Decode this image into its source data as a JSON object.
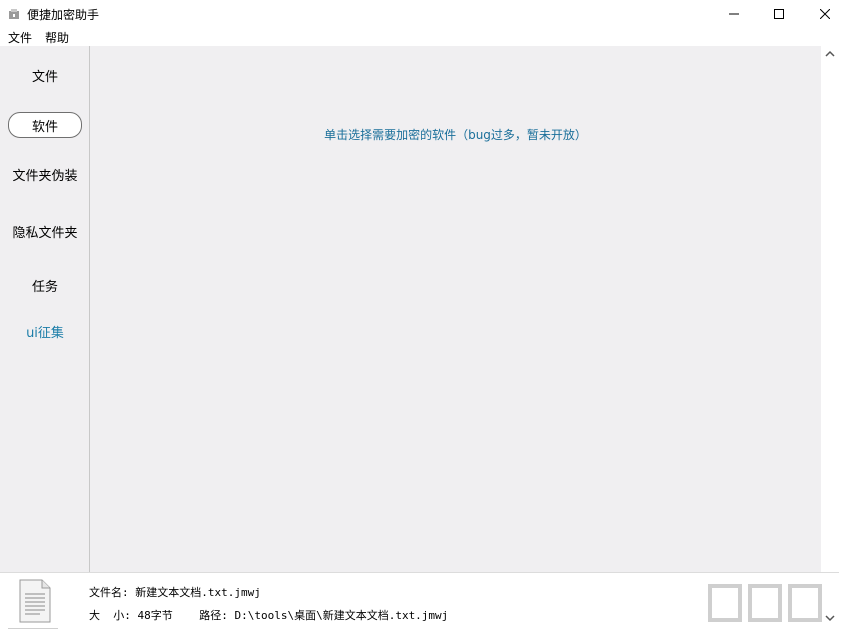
{
  "window": {
    "title": "便捷加密助手",
    "controls": {
      "minimize": "minimize-icon",
      "maximize": "maximize-icon",
      "close": "close-icon"
    }
  },
  "menubar": {
    "items": [
      "文件",
      "帮助"
    ]
  },
  "sidebar": {
    "items": [
      {
        "label": "文件",
        "active": false
      },
      {
        "label": "软件",
        "active": true
      },
      {
        "label": "文件夹伪装",
        "active": false
      },
      {
        "label": "隐私文件夹",
        "active": false
      },
      {
        "label": "任务",
        "active": false
      },
      {
        "label": "ui征集",
        "active": false,
        "accent": "#1b7da8"
      }
    ]
  },
  "content": {
    "message": "单击选择需要加密的软件（bug过多，暂未开放）"
  },
  "statusbar": {
    "file_name_line": "文件名: 新建文本文档.txt.jmwj",
    "size_path_line": "大  小: 48字节    路径: D:\\tools\\桌面\\新建文本文档.txt.jmwj"
  },
  "colors": {
    "panel_bg": "#f0eff1",
    "accent_text": "#1a6f9a"
  }
}
